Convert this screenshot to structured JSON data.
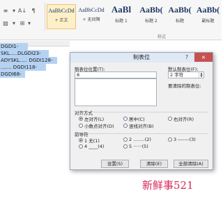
{
  "ribbon": {
    "para_icons": {
      "list_multi": "≡",
      "align_dist": "⇅",
      "sort": "A↓",
      "marks": "¶",
      "shading": "🖌",
      "border": "⊞"
    },
    "styles": [
      {
        "preview": "AaBbCcDd",
        "name": "+ 正文",
        "selected": true
      },
      {
        "preview": "AaBbCcDd",
        "name": "+ 无间隔",
        "selected": false
      },
      {
        "preview": "AaBl",
        "name": "标题 1",
        "selected": false
      },
      {
        "preview": "AaBb(",
        "name": "标题 2",
        "selected": false
      },
      {
        "preview": "AaBb(",
        "name": "标题",
        "selected": false
      },
      {
        "preview": "AaBb(",
        "name": "副标题",
        "selected": false
      }
    ],
    "styles_group_label": "样式"
  },
  "document": {
    "lines": [
      "DGDI1-",
      "SKL.....DLGDI23-",
      "ADYSKL..... DGDI128-",
      "....... DGDI118-",
      "DGDI68-"
    ]
  },
  "dialog": {
    "title": "制表位",
    "help": "?",
    "close": "×",
    "tab_position_label": "制表位位置(T):",
    "tab_position_value": "8",
    "default_tab_label": "默认制表位(F):",
    "default_tab_value": "2 字符",
    "clear_label": "要清除的制表位:",
    "alignment_label": "对齐方式",
    "alignment_options": [
      {
        "label": "左对齐(L)",
        "checked": true
      },
      {
        "label": "居中(C)",
        "checked": false
      },
      {
        "label": "右对齐(R)",
        "checked": false
      },
      {
        "label": "小数点对齐(D)",
        "checked": false
      },
      {
        "label": "竖线对齐(B)",
        "checked": false
      }
    ],
    "leader_label": "前导符",
    "leader_options": [
      {
        "label": "1 无(1)",
        "checked": true
      },
      {
        "label": "2 ........(2)",
        "checked": false
      },
      {
        "label": "3 -------(3)",
        "checked": false
      },
      {
        "label": "4 ____(4)",
        "checked": false
      },
      {
        "label": "5 ······(5)",
        "checked": false
      }
    ],
    "buttons": {
      "set": "设置(S)",
      "clear": "清除(E)",
      "clear_all": "全部清除(A)"
    }
  },
  "watermark": "新鲜事521"
}
